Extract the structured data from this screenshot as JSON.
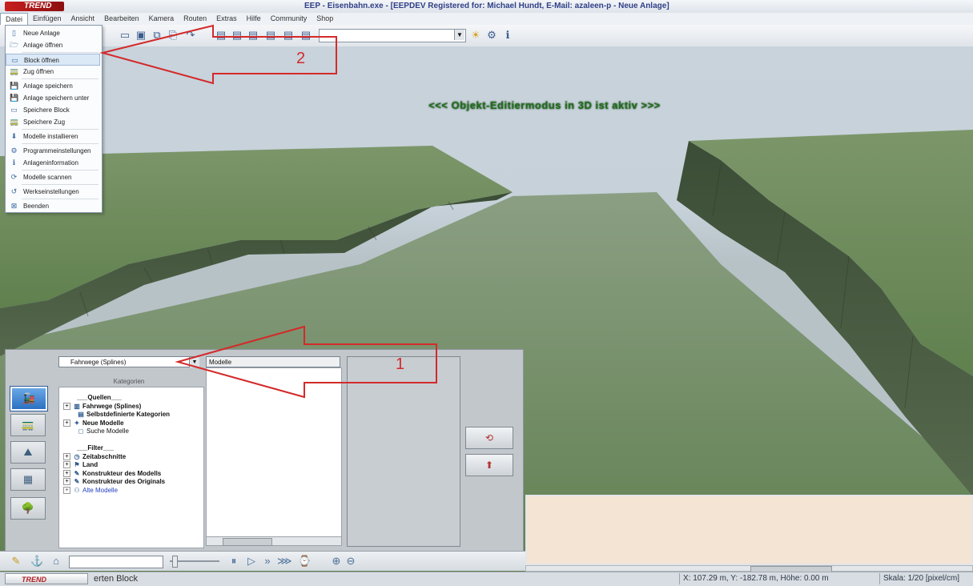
{
  "window": {
    "title": "EEP - Eisenbahn.exe - [EEPDEV Registered for: Michael Hundt, E-Mail: azaleen-p - Neue Anlage]",
    "logo_text": "TREND"
  },
  "menubar": {
    "items": [
      {
        "label": "Datei",
        "active": true
      },
      {
        "label": "Einfügen"
      },
      {
        "label": "Ansicht"
      },
      {
        "label": "Bearbeiten"
      },
      {
        "label": "Kamera"
      },
      {
        "label": "Routen"
      },
      {
        "label": "Extras"
      },
      {
        "label": "Hilfe"
      },
      {
        "label": "Community"
      },
      {
        "label": "Shop"
      }
    ]
  },
  "file_menu": {
    "items": [
      {
        "label": "Neue Anlage",
        "icon": "new-file-icon"
      },
      {
        "label": "Anlage öffnen",
        "icon": "open-folder-icon"
      },
      {
        "label": "Block öffnen",
        "icon": "open-block-icon",
        "selected": true
      },
      {
        "label": "Zug öffnen",
        "icon": "open-train-icon"
      },
      {
        "label": "Anlage speichern",
        "icon": "save-icon"
      },
      {
        "label": "Anlage speichern unter",
        "icon": "save-as-icon"
      },
      {
        "label": "Speichere Block",
        "icon": "save-block-icon"
      },
      {
        "label": "Speichere Zug",
        "icon": "save-train-icon"
      },
      {
        "label": "Modelle installieren",
        "icon": "install-icon"
      },
      {
        "label": "Programmeinstellungen",
        "icon": "settings-icon"
      },
      {
        "label": "Anlageninformation",
        "icon": "info-icon"
      },
      {
        "label": "Modelle scannen",
        "icon": "scan-icon"
      },
      {
        "label": "Werkseinstellungen",
        "icon": "reset-icon"
      },
      {
        "label": "Beenden",
        "icon": "exit-icon"
      }
    ]
  },
  "viewport": {
    "mode_banner": "<<<  Objekt-Editiermodus in 3D ist aktiv  >>>"
  },
  "editor_panel": {
    "category_select": "Fahrwege (Splines)",
    "categories_caption": "Kategorien",
    "models_header": "Modelle",
    "tree": [
      {
        "label": "___Quellen___",
        "bold": true,
        "indent": 1,
        "expander": false
      },
      {
        "label": "Fahrwege (Splines)",
        "bold": true,
        "indent": 0,
        "expander": true,
        "icon": "track-icon"
      },
      {
        "label": "Selbstdefinierte Kategorien",
        "bold": true,
        "indent": 1,
        "expander": false,
        "icon": "custom-category-icon"
      },
      {
        "label": "Neue Modelle",
        "bold": true,
        "indent": 0,
        "expander": true,
        "icon": "new-models-icon"
      },
      {
        "label": "Suche Modelle",
        "bold": false,
        "indent": 1,
        "expander": false,
        "icon": "search-icon"
      },
      {
        "label": "",
        "bold": false,
        "indent": 1,
        "expander": false
      },
      {
        "label": "___Filter___",
        "bold": true,
        "indent": 1,
        "expander": false
      },
      {
        "label": "Zeitabschnitte",
        "bold": true,
        "indent": 0,
        "expander": true,
        "icon": "clock-icon"
      },
      {
        "label": "Land",
        "bold": true,
        "indent": 0,
        "expander": true,
        "icon": "flag-icon"
      },
      {
        "label": "Konstrukteur des Modells",
        "bold": true,
        "indent": 0,
        "expander": true,
        "icon": "author-icon"
      },
      {
        "label": "Konstrukteur des Originals",
        "bold": true,
        "indent": 0,
        "expander": true,
        "icon": "author-icon"
      },
      {
        "label": "Alte Modelle",
        "bold": false,
        "indent": 0,
        "expander": true,
        "icon": "old-models-icon",
        "color": "#2040c0"
      }
    ]
  },
  "statusbar": {
    "message": "erten Block",
    "coords": "X: 107.29 m, Y: -182.78 m, Höhe: 0.00 m",
    "scale": "Skala: 1/20 [pixel/cm]"
  },
  "annotations": {
    "arrow1_label": "1",
    "arrow2_label": "2"
  },
  "colors": {
    "annotation_red": "#d32a2a",
    "banner_green": "#1f6f1b",
    "terrain_green": "#6e8a58"
  }
}
